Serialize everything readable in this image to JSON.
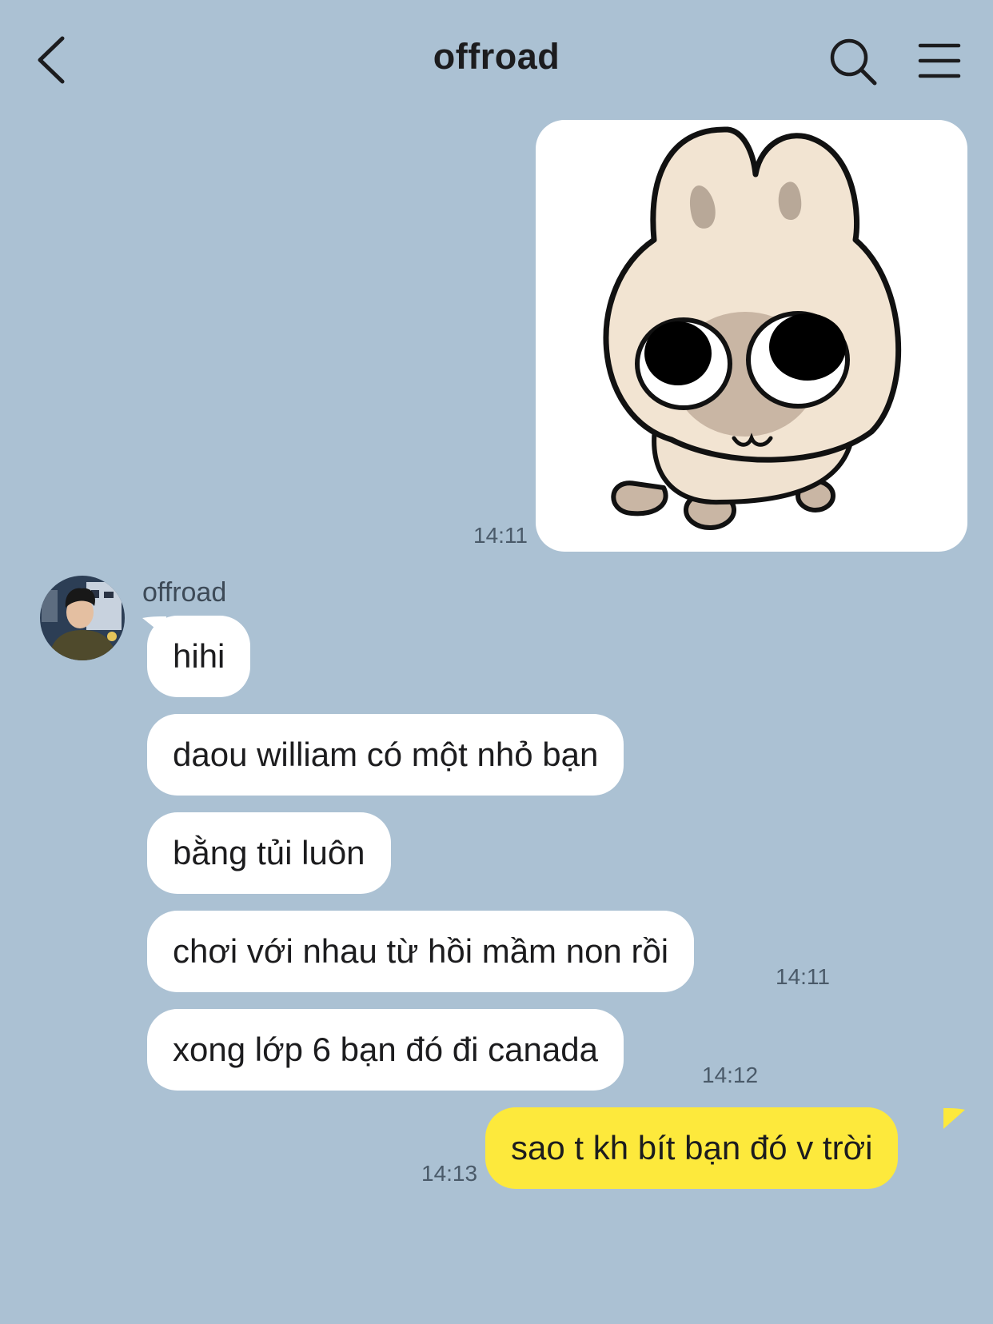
{
  "header": {
    "title": "offroad",
    "back_icon": "chevron-left-icon",
    "search_icon": "search-icon",
    "menu_icon": "hamburger-menu-icon"
  },
  "messages": {
    "sticker": {
      "icon": "cat-bunny-sticker",
      "time": "14:11"
    },
    "received": {
      "sender": "offroad",
      "bubbles": [
        {
          "text": "hihi",
          "time": ""
        },
        {
          "text": "daou william có một nhỏ bạn",
          "time": ""
        },
        {
          "text": "bằng tủi luôn",
          "time": ""
        },
        {
          "text": "chơi với nhau từ hồi mầm non rồi",
          "time": "14:11"
        },
        {
          "text": "xong lớp 6 bạn đó đi canada",
          "time": "14:12"
        }
      ]
    },
    "sent": {
      "text": "sao t kh bít bạn đó v trời",
      "time": "14:13"
    }
  },
  "colors": {
    "background": "#abc1d3",
    "received_bubble": "#ffffff",
    "sent_bubble": "#fde93c",
    "timestamp": "#4a5a69"
  }
}
